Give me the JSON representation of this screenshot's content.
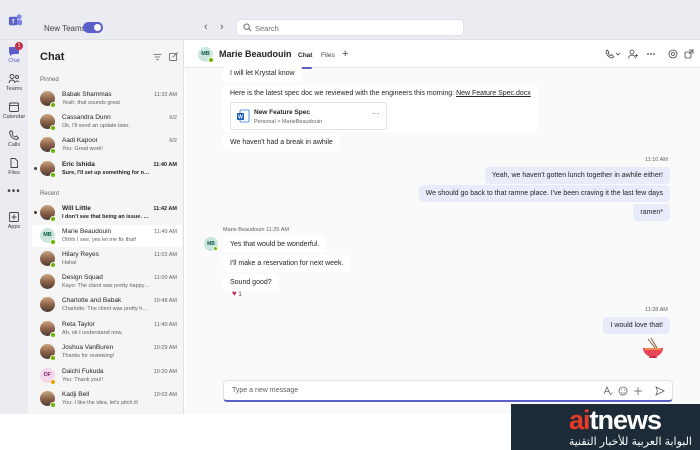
{
  "topbar": {
    "new_teams_label": "New Teams",
    "new_teams_enabled": true,
    "back_arrow": "‹",
    "forward_arrow": "›",
    "search_placeholder": "Search"
  },
  "rail": {
    "items": [
      {
        "label": "Chat",
        "icon": "chat-icon",
        "badge": "1",
        "active": true
      },
      {
        "label": "Teams",
        "icon": "teams-icon"
      },
      {
        "label": "Calendar",
        "icon": "calendar-icon"
      },
      {
        "label": "Calls",
        "icon": "phone-icon"
      },
      {
        "label": "Files",
        "icon": "file-icon"
      },
      {
        "label": "Apps",
        "icon": "add-apps-icon"
      }
    ],
    "more_label": "•••"
  },
  "chat_list": {
    "title": "Chat",
    "pinned_label": "Pinned",
    "recent_label": "Recent",
    "pinned": [
      {
        "name": "Babak Shammas",
        "preview": "Yeah, that sounds great",
        "time": "11:32 AM",
        "avatar": "photo",
        "presence": "available"
      },
      {
        "name": "Cassandra Dunn",
        "preview": "Ok, I'll send an update later.",
        "time": "6/2",
        "avatar": "photo",
        "presence": "available"
      },
      {
        "name": "Aadi Kapoor",
        "preview": "You: Great work!",
        "time": "6/2",
        "avatar": "photo",
        "presence": "available"
      },
      {
        "name": "Eric Ishida",
        "preview": "Sure, I'll set up something for next week t...",
        "time": "11:40 AM",
        "avatar": "photo",
        "presence": "available",
        "unread": true
      }
    ],
    "recent": [
      {
        "name": "Will Little",
        "preview": "I don't see that being an issue. Can you ta...",
        "time": "11:42 AM",
        "avatar": "photo",
        "presence": "available",
        "unread": true
      },
      {
        "name": "Marie Beaudouin",
        "preview": "Ohhh I see, yes let me fix that!",
        "time": "11:40 AM",
        "avatar": "initials",
        "initials": "MB",
        "presence": "available",
        "selected": true
      },
      {
        "name": "Hilary Reyes",
        "preview": "Haha!",
        "time": "11:02 AM",
        "avatar": "photo",
        "presence": "available"
      },
      {
        "name": "Design Squad",
        "preview": "Kayo: The client was pretty happy with...",
        "time": "11:00 AM",
        "avatar": "photo",
        "presence": "none"
      },
      {
        "name": "Charlotte and Babak",
        "preview": "Charlotte: The client was pretty happy with...",
        "time": "10:48 AM",
        "avatar": "photo",
        "presence": "none"
      },
      {
        "name": "Reta Taylor",
        "preview": "Ah, ok I understand now.",
        "time": "11:40 AM",
        "avatar": "photo",
        "presence": "available"
      },
      {
        "name": "Joshua VanBuren",
        "preview": "Thanks for reviewing!",
        "time": "10:29 AM",
        "avatar": "photo",
        "presence": "available"
      },
      {
        "name": "Daichi Fukuda",
        "preview": "You: Thank you!!",
        "time": "10:20 AM",
        "avatar": "initials",
        "initials": "DF",
        "presence": "away"
      },
      {
        "name": "Kadji Bell",
        "preview": "You: I like the idea, let's pitch it!",
        "time": "10:02 AM",
        "avatar": "photo",
        "presence": "available"
      }
    ]
  },
  "conversation": {
    "contact_name": "Marie Beaudouin",
    "contact_initials": "MB",
    "tabs": [
      "Chat",
      "Files"
    ],
    "add_tab": "+",
    "messages": {
      "m1": "I will let Krystal know",
      "m2_text": "Here is the latest spec doc we reviewed with the engineers this morning: ",
      "m2_link": "New Feature Spec.docx",
      "file_name": "New Feature Spec",
      "file_path": "Personal > MarieBeaudouin",
      "file_more": "···",
      "m3": "We haven't had a break in awhile",
      "time_out1": "11:10 AM",
      "o1": "Yeah, we haven't gotten lunch together in awhile either!",
      "o2": "We should go back to that ramne place. I've been craving it the last few days",
      "o3": "ramen*",
      "sender_meta": "Marie Beaudouin   11:25 AM",
      "i1": "Yes that would be wonderful.",
      "i2": "I'll make a reservation for next week.",
      "i3": "Sound good?",
      "reaction_count": "1",
      "time_out2": "11:28 AM",
      "o4": "I would love that!"
    },
    "compose_placeholder": "Type a new message"
  },
  "watermark": {
    "logo_ai": "ai",
    "logo_rest": "tnews",
    "tagline": "البوابة العربية للأخبار التقنية"
  },
  "colors": {
    "accent": "#5b5fc7",
    "outgoing_bubble": "#e8ebfa",
    "available": "#6bb700",
    "away": "#eaa300",
    "badge": "#c4314b"
  }
}
